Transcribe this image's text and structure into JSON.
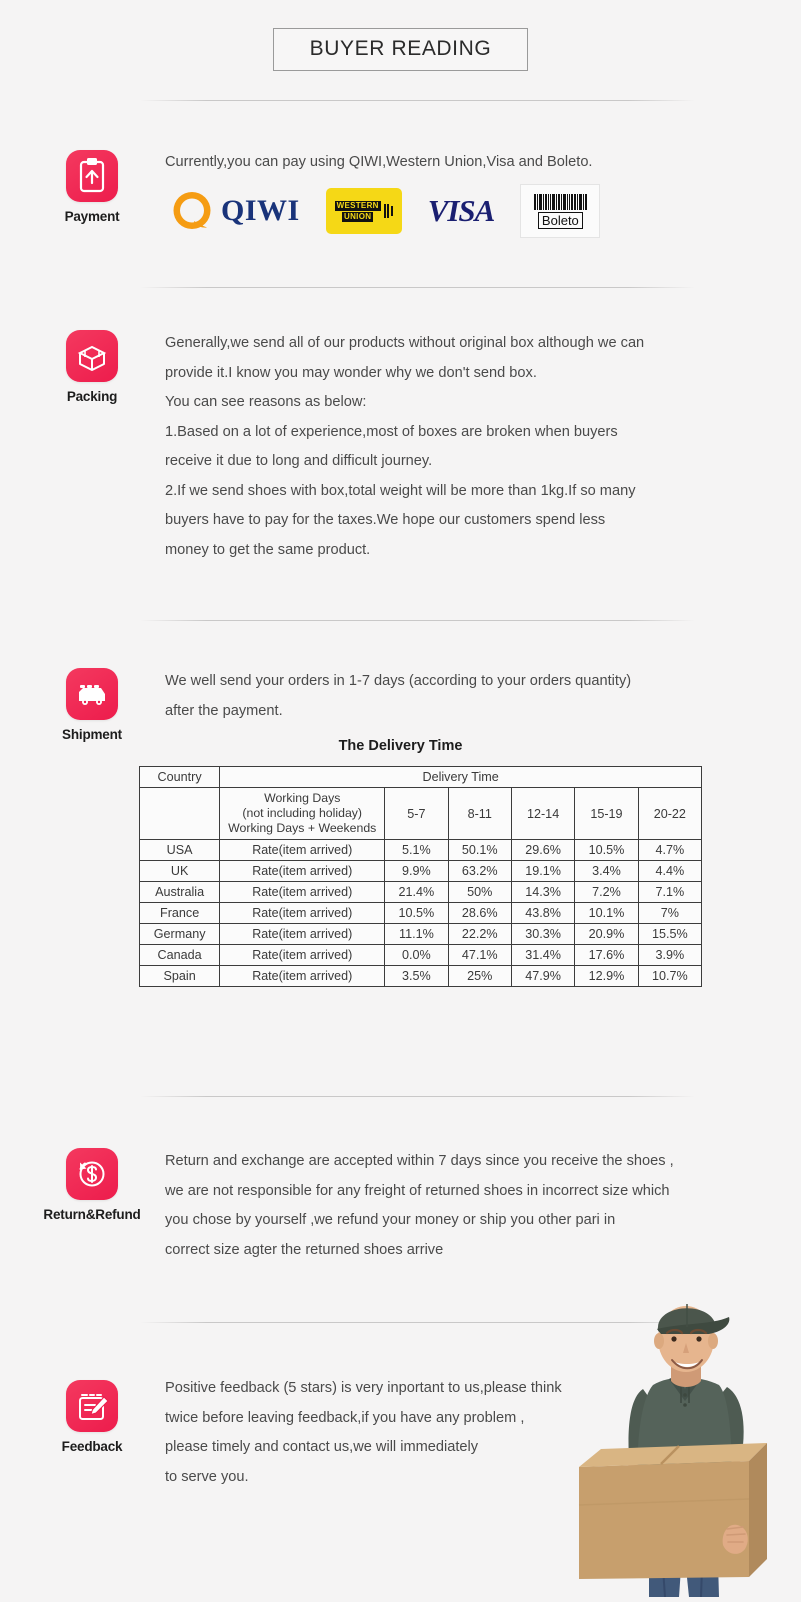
{
  "header": {
    "title": "BUYER READING"
  },
  "sections": {
    "payment": {
      "icon_name": "payment-clipboard-icon",
      "label": "Payment",
      "text": "Currently,you can pay using QIWI,Western Union,Visa and Boleto.",
      "logos": [
        {
          "name": "qiwi-logo",
          "text": "QIWI"
        },
        {
          "name": "western-union-logo",
          "line1": "WESTERN",
          "line2": "UNION"
        },
        {
          "name": "visa-logo",
          "text": "VISA"
        },
        {
          "name": "boleto-logo",
          "text": "Boleto"
        }
      ]
    },
    "packing": {
      "icon_name": "open-box-icon",
      "label": "Packing",
      "lines": [
        "Generally,we send all of our products without original box although we can",
        "provide it.I know you may wonder why we don't send box.",
        "You can see reasons as below:",
        "1.Based on a lot of experience,most of boxes are broken when buyers",
        "receive it due to long and difficult journey.",
        "2.If we send shoes with box,total weight will be more than 1kg.If so many",
        "buyers have to pay for the taxes.We hope our customers spend less",
        "money to get the same product."
      ]
    },
    "shipment": {
      "icon_name": "delivery-van-icon",
      "label": "Shipment",
      "lines": [
        "We well send your orders in 1-7 days (according to your orders quantity)",
        "after the payment."
      ],
      "table_title": "The Delivery Time"
    },
    "refund": {
      "icon_name": "refund-dollar-icon",
      "label": "Return&Refund",
      "lines": [
        "Return and exchange are accepted within 7 days since you receive the shoes ,",
        "we are not responsible for any freight of returned shoes in incorrect size which",
        "you chose by yourself ,we refund your money or ship you other pari in",
        "correct size agter the returned shoes arrive"
      ]
    },
    "feedback": {
      "icon_name": "feedback-pencil-icon",
      "label": "Feedback",
      "lines": [
        "Positive feedback (5 stars) is very inportant to us,please think",
        "twice before leaving feedback,if you have any problem ,",
        "please timely and contact us,we will immediately",
        "to serve you."
      ]
    }
  },
  "delivery_table": {
    "header_country": "Country",
    "header_delivery_time": "Delivery Time",
    "working_days_lines": [
      "Working Days",
      "(not including holiday)",
      "Working Days + Weekends"
    ],
    "ranges": [
      "5-7",
      "8-11",
      "12-14",
      "15-19",
      "20-22"
    ],
    "rate_label": "Rate(item arrived)",
    "rows": [
      {
        "country": "USA",
        "values": [
          "5.1%",
          "50.1%",
          "29.6%",
          "10.5%",
          "4.7%"
        ]
      },
      {
        "country": "UK",
        "values": [
          "9.9%",
          "63.2%",
          "19.1%",
          "3.4%",
          "4.4%"
        ]
      },
      {
        "country": "Australia",
        "values": [
          "21.4%",
          "50%",
          "14.3%",
          "7.2%",
          "7.1%"
        ]
      },
      {
        "country": "France",
        "values": [
          "10.5%",
          "28.6%",
          "43.8%",
          "10.1%",
          "7%"
        ]
      },
      {
        "country": "Germany",
        "values": [
          "11.1%",
          "22.2%",
          "30.3%",
          "20.9%",
          "15.5%"
        ]
      },
      {
        "country": "Canada",
        "values": [
          "0.0%",
          "47.1%",
          "31.4%",
          "17.6%",
          "3.9%"
        ]
      },
      {
        "country": "Spain",
        "values": [
          "3.5%",
          "25%",
          "47.9%",
          "12.9%",
          "10.7%"
        ]
      }
    ]
  },
  "courier_image": {
    "name": "delivery-man-photo",
    "alt": "Delivery man holding a cardboard box"
  },
  "colors": {
    "background": "#f5f4f4",
    "icon_pink": "#ed1c4c",
    "qiwi_orange": "#f59c12",
    "qiwi_blue": "#19337a",
    "western_union_yellow": "#f5d816",
    "visa_blue": "#1a1f71",
    "text": "#4a4a4a",
    "heading": "#1d1d1d"
  }
}
